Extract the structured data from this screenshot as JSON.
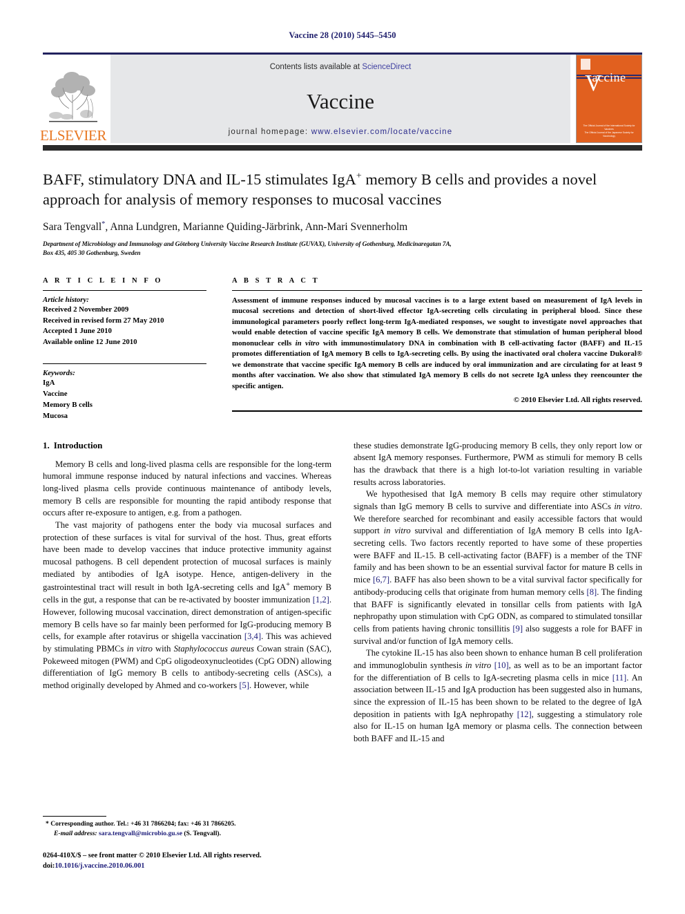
{
  "running_head": "Vaccine 28 (2010) 5445–5450",
  "journal_header": {
    "contents_prefix": "Contents lists available at ",
    "sciencedirect": "ScienceDirect",
    "journal_name": "Vaccine",
    "homepage_prefix": "journal homepage: ",
    "homepage_url": "www.elsevier.com/locate/vaccine",
    "publisher": "ELSEVIER",
    "cover": {
      "title": "accine",
      "v": "V",
      "footer_line1": "The Official Journal of the International Society for Vaccines",
      "footer_line2": "The Official Journal of the Japanese Society for Vaccinology"
    }
  },
  "article": {
    "title_part1": "BAFF, stimulatory DNA and IL-15 stimulates IgA",
    "title_sup": "+",
    "title_part2": " memory B cells and provides a novel approach for analysis of memory responses to mucosal vaccines",
    "authors": "Sara Tengvall",
    "author_marker": "*",
    "authors_rest": ", Anna Lundgren, Marianne Quiding-Järbrink, Ann-Mari Svennerholm",
    "affiliation_line1": "Department of Microbiology and Immunology and Göteborg University Vaccine Research Institute (GUVAX), University of Gothenburg, Medicinaregatan 7A,",
    "affiliation_line2": "Box 435, 405 30 Gothenburg, Sweden"
  },
  "article_info": {
    "label": "A R T I C L E   I N F O",
    "history_label": "Article history:",
    "history": [
      "Received 2 November 2009",
      "Received in revised form 27 May 2010",
      "Accepted 1 June 2010",
      "Available online 12 June 2010"
    ],
    "keywords_label": "Keywords:",
    "keywords": [
      "IgA",
      "Vaccine",
      "Memory B cells",
      "Mucosa"
    ]
  },
  "abstract": {
    "label": "A B S T R A C T",
    "text_part1": "Assessment of immune responses induced by mucosal vaccines is to a large extent based on measurement of IgA levels in mucosal secretions and detection of short-lived effector IgA-secreting cells circulating in peripheral blood. Since these immunological parameters poorly reflect long-term IgA-mediated responses, we sought to investigate novel approaches that would enable detection of vaccine specific IgA memory B cells. We demonstrate that stimulation of human peripheral blood mononuclear cells ",
    "italic1": "in vitro",
    "text_part2": " with immunostimulatory DNA in combination with B cell-activating factor (BAFF) and IL-15 promotes differentiation of IgA memory B cells to IgA-secreting cells. By using the inactivated oral cholera vaccine Dukoral® we demonstrate that vaccine specific IgA memory B cells are induced by oral immunization and are circulating for at least 9 months after vaccination. We also show that stimulated IgA memory B cells do not secrete IgA unless they reencounter the specific antigen.",
    "copyright": "© 2010 Elsevier Ltd. All rights reserved."
  },
  "introduction": {
    "heading_number": "1.",
    "heading_title": "Introduction",
    "left_paragraphs": [
      "Memory B cells and long-lived plasma cells are responsible for the long-term humoral immune response induced by natural infections and vaccines. Whereas long-lived plasma cells provide continuous maintenance of antibody levels, memory B cells are responsible for mounting the rapid antibody response that occurs after re-exposure to antigen, e.g. from a pathogen."
    ],
    "left_para2_a": "The vast majority of pathogens enter the body via mucosal surfaces and protection of these surfaces is vital for survival of the host. Thus, great efforts have been made to develop vaccines that induce protective immunity against mucosal pathogens. B cell dependent protection of mucosal surfaces is mainly mediated by antibodies of IgA isotype. Hence, antigen-delivery in the gastrointestinal tract will result in both IgA-secreting cells and IgA",
    "left_para2_sup": "+",
    "left_para2_b": " memory B cells in the gut, a response that can be re-activated by booster immunization ",
    "ref_12": "[1,2]",
    "left_para2_c": ". However, following mucosal vaccination, direct demonstration of antigen-specific memory B cells have so far mainly been performed for IgG-producing memory B cells, for example after rotavirus or shigella vaccination ",
    "ref_34": "[3,4]",
    "left_para2_d": ". This was achieved by stimulating PBMCs ",
    "italic_invitro": "in vitro",
    "left_para2_e": " with ",
    "italic_staph": "Staphylococcus aureus",
    "left_para2_f": " Cowan strain (SAC), Pokeweed mitogen (PWM) and CpG oligodeoxynucleotides (CpG ODN) allowing differentiation of IgG memory B cells to antibody-secreting cells (ASCs), a method originally developed by Ahmed and co-workers ",
    "ref_5": "[5]",
    "left_para2_g": ". However, while",
    "right_para1_a": "these studies demonstrate IgG-producing memory B cells, they only report low or absent IgA memory responses. Furthermore, PWM as stimuli for memory B cells has the drawback that there is a high lot-to-lot variation resulting in variable results across laboratories.",
    "right_para2_a": "We hypothesised that IgA memory B cells may require other stimulatory signals than IgG memory B cells to survive and differentiate into ASCs ",
    "italic_invitro2": "in vitro",
    "right_para2_b": ". We therefore searched for recombinant and easily accessible factors that would support ",
    "italic_invitro3": "in vitro",
    "right_para2_c": " survival and differentiation of IgA memory B cells into IgA-secreting cells. Two factors recently reported to have some of these properties were BAFF and IL-15. B cell-activating factor (BAFF) is a member of the TNF family and has been shown to be an essential survival factor for mature B cells in mice ",
    "ref_67": "[6,7]",
    "right_para2_d": ". BAFF has also been shown to be a vital survival factor specifically for antibody-producing cells that originate from human memory cells ",
    "ref_8": "[8]",
    "right_para2_e": ". The finding that BAFF is significantly elevated in tonsillar cells from patients with IgA nephropathy upon stimulation with CpG ODN, as compared to stimulated tonsillar cells from patients having chronic tonsillitis ",
    "ref_9": "[9]",
    "right_para2_f": " also suggests a role for BAFF in survival and/or function of IgA memory cells.",
    "right_para3_a": "The cytokine IL-15 has also been shown to enhance human B cell proliferation and immunoglobulin synthesis ",
    "italic_invitro4": "in vitro",
    "right_para3_b": " ",
    "ref_10": "[10]",
    "right_para3_c": ", as well as to be an important factor for the differentiation of B cells to IgA-secreting plasma cells in mice ",
    "ref_11": "[11]",
    "right_para3_d": ". An association between IL-15 and IgA production has been suggested also in humans, since the expression of IL-15 has been shown to be related to the degree of IgA deposition in patients with IgA nephropathy ",
    "ref_12b": "[12]",
    "right_para3_e": ", suggesting a stimulatory role also for IL-15 on human IgA memory or plasma cells. The connection between both BAFF and IL-15 and"
  },
  "footnote": {
    "marker": "*",
    "corresponding": " Corresponding author. Tel.: +46 31 7866204; fax: +46 31 7866205.",
    "email_label": "E-mail address:",
    "email": "sara.tengvall@microbio.gu.se",
    "email_owner": " (S. Tengvall)."
  },
  "imprint": {
    "line1": "0264-410X/$ – see front matter © 2010 Elsevier Ltd. All rights reserved.",
    "doi_label": "doi:",
    "doi_value": "10.1016/j.vaccine.2010.06.001"
  },
  "colors": {
    "accent_orange": "#e87722",
    "link_blue": "#1d1d7a",
    "header_gray": "#e6e7e9",
    "cover_orange": "#e1601f"
  }
}
